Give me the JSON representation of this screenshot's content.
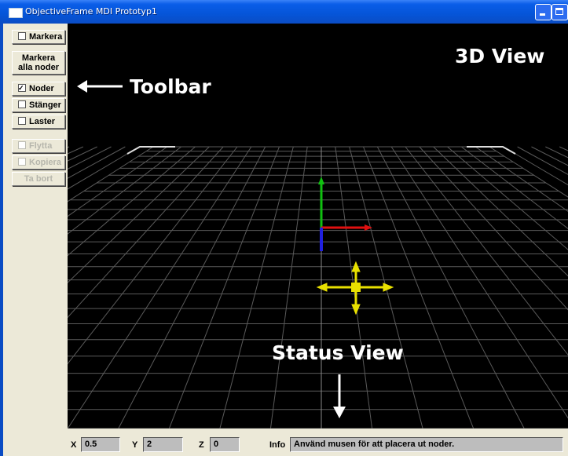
{
  "window": {
    "title": "ObjectiveFrame MDI Prototyp1"
  },
  "toolbar": {
    "markera": "Markera",
    "markera_alla_line1": "Markera",
    "markera_alla_line2": "alla noder",
    "noder": "Noder",
    "noder_checked": true,
    "stanger": "Stänger",
    "laster": "Laster",
    "flytta": "Flytta",
    "kopiera": "Kopiera",
    "ta_bort": "Ta bort"
  },
  "annotations": {
    "view3d": "3D View",
    "toolbar": "Toolbar",
    "status_view": "Status View"
  },
  "status": {
    "x_label": "X",
    "x_value": "0.5",
    "y_label": "Y",
    "y_value": "2",
    "z_label": "Z",
    "z_value": "0",
    "info_label": "Info",
    "info_text": "Använd musen för att placera ut noder."
  },
  "colors": {
    "axis_x": "#e01010",
    "axis_y": "#10c010",
    "axis_z": "#2020e0",
    "gizmo": "#e8e000",
    "grid": "#5a5a5a"
  },
  "icons": [
    "window-icon",
    "minimize-icon",
    "maximize-icon",
    "close-icon",
    "left-arrow-icon",
    "down-arrow-icon"
  ]
}
